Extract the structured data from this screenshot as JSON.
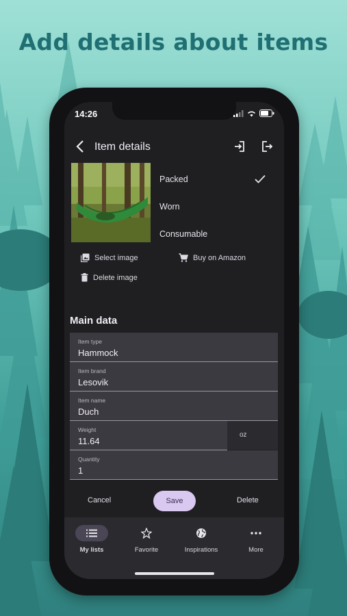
{
  "headline": "Add details about items",
  "status": {
    "time": "14:26"
  },
  "header": {
    "title": "Item details"
  },
  "options": [
    "Packed",
    "Worn",
    "Consumable"
  ],
  "image_actions": {
    "select": "Select image",
    "amazon": "Buy on Amazon",
    "delete": "Delete image"
  },
  "main": {
    "section_title": "Main data",
    "fields": [
      {
        "label": "Item type",
        "value": "Hammock"
      },
      {
        "label": "Item brand",
        "value": "Lesovik"
      },
      {
        "label": "Item name",
        "value": "Duch"
      },
      {
        "label": "Weight",
        "value": "11.64"
      },
      {
        "label": "Quantity",
        "value": "1"
      }
    ],
    "weight_unit": "oz"
  },
  "buttons": {
    "cancel": "Cancel",
    "save": "Save",
    "delete": "Delete"
  },
  "nav": [
    {
      "label": "My lists",
      "icon": "list-icon",
      "active": true
    },
    {
      "label": "Favorite",
      "icon": "star-icon",
      "active": false
    },
    {
      "label": "Inspirations",
      "icon": "globe-icon",
      "active": false
    },
    {
      "label": "More",
      "icon": "more-icon",
      "active": false
    }
  ],
  "colors": {
    "accent": "#d9c8ef",
    "screen_bg": "#1f1f22",
    "headline": "#1f6f73"
  }
}
